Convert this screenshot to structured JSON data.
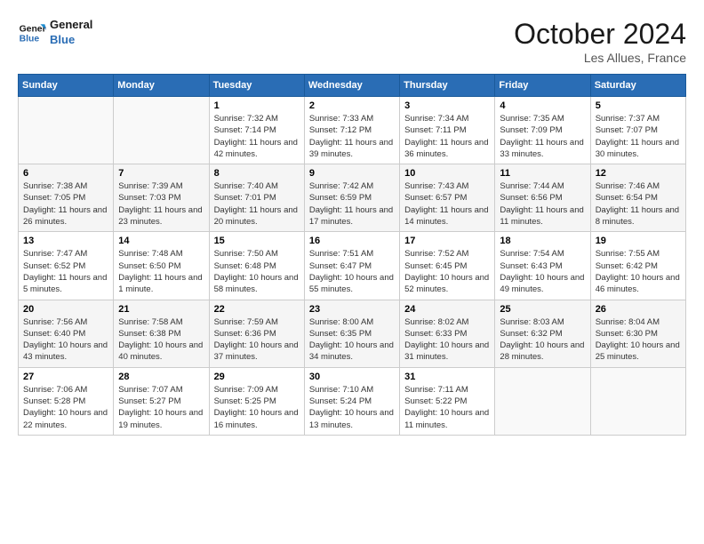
{
  "logo": {
    "line1": "General",
    "line2": "Blue"
  },
  "title": "October 2024",
  "location": "Les Allues, France",
  "days_header": [
    "Sunday",
    "Monday",
    "Tuesday",
    "Wednesday",
    "Thursday",
    "Friday",
    "Saturday"
  ],
  "weeks": [
    [
      {
        "day": "",
        "sunrise": "",
        "sunset": "",
        "daylight": ""
      },
      {
        "day": "",
        "sunrise": "",
        "sunset": "",
        "daylight": ""
      },
      {
        "day": "1",
        "sunrise": "Sunrise: 7:32 AM",
        "sunset": "Sunset: 7:14 PM",
        "daylight": "Daylight: 11 hours and 42 minutes."
      },
      {
        "day": "2",
        "sunrise": "Sunrise: 7:33 AM",
        "sunset": "Sunset: 7:12 PM",
        "daylight": "Daylight: 11 hours and 39 minutes."
      },
      {
        "day": "3",
        "sunrise": "Sunrise: 7:34 AM",
        "sunset": "Sunset: 7:11 PM",
        "daylight": "Daylight: 11 hours and 36 minutes."
      },
      {
        "day": "4",
        "sunrise": "Sunrise: 7:35 AM",
        "sunset": "Sunset: 7:09 PM",
        "daylight": "Daylight: 11 hours and 33 minutes."
      },
      {
        "day": "5",
        "sunrise": "Sunrise: 7:37 AM",
        "sunset": "Sunset: 7:07 PM",
        "daylight": "Daylight: 11 hours and 30 minutes."
      }
    ],
    [
      {
        "day": "6",
        "sunrise": "Sunrise: 7:38 AM",
        "sunset": "Sunset: 7:05 PM",
        "daylight": "Daylight: 11 hours and 26 minutes."
      },
      {
        "day": "7",
        "sunrise": "Sunrise: 7:39 AM",
        "sunset": "Sunset: 7:03 PM",
        "daylight": "Daylight: 11 hours and 23 minutes."
      },
      {
        "day": "8",
        "sunrise": "Sunrise: 7:40 AM",
        "sunset": "Sunset: 7:01 PM",
        "daylight": "Daylight: 11 hours and 20 minutes."
      },
      {
        "day": "9",
        "sunrise": "Sunrise: 7:42 AM",
        "sunset": "Sunset: 6:59 PM",
        "daylight": "Daylight: 11 hours and 17 minutes."
      },
      {
        "day": "10",
        "sunrise": "Sunrise: 7:43 AM",
        "sunset": "Sunset: 6:57 PM",
        "daylight": "Daylight: 11 hours and 14 minutes."
      },
      {
        "day": "11",
        "sunrise": "Sunrise: 7:44 AM",
        "sunset": "Sunset: 6:56 PM",
        "daylight": "Daylight: 11 hours and 11 minutes."
      },
      {
        "day": "12",
        "sunrise": "Sunrise: 7:46 AM",
        "sunset": "Sunset: 6:54 PM",
        "daylight": "Daylight: 11 hours and 8 minutes."
      }
    ],
    [
      {
        "day": "13",
        "sunrise": "Sunrise: 7:47 AM",
        "sunset": "Sunset: 6:52 PM",
        "daylight": "Daylight: 11 hours and 5 minutes."
      },
      {
        "day": "14",
        "sunrise": "Sunrise: 7:48 AM",
        "sunset": "Sunset: 6:50 PM",
        "daylight": "Daylight: 11 hours and 1 minute."
      },
      {
        "day": "15",
        "sunrise": "Sunrise: 7:50 AM",
        "sunset": "Sunset: 6:48 PM",
        "daylight": "Daylight: 10 hours and 58 minutes."
      },
      {
        "day": "16",
        "sunrise": "Sunrise: 7:51 AM",
        "sunset": "Sunset: 6:47 PM",
        "daylight": "Daylight: 10 hours and 55 minutes."
      },
      {
        "day": "17",
        "sunrise": "Sunrise: 7:52 AM",
        "sunset": "Sunset: 6:45 PM",
        "daylight": "Daylight: 10 hours and 52 minutes."
      },
      {
        "day": "18",
        "sunrise": "Sunrise: 7:54 AM",
        "sunset": "Sunset: 6:43 PM",
        "daylight": "Daylight: 10 hours and 49 minutes."
      },
      {
        "day": "19",
        "sunrise": "Sunrise: 7:55 AM",
        "sunset": "Sunset: 6:42 PM",
        "daylight": "Daylight: 10 hours and 46 minutes."
      }
    ],
    [
      {
        "day": "20",
        "sunrise": "Sunrise: 7:56 AM",
        "sunset": "Sunset: 6:40 PM",
        "daylight": "Daylight: 10 hours and 43 minutes."
      },
      {
        "day": "21",
        "sunrise": "Sunrise: 7:58 AM",
        "sunset": "Sunset: 6:38 PM",
        "daylight": "Daylight: 10 hours and 40 minutes."
      },
      {
        "day": "22",
        "sunrise": "Sunrise: 7:59 AM",
        "sunset": "Sunset: 6:36 PM",
        "daylight": "Daylight: 10 hours and 37 minutes."
      },
      {
        "day": "23",
        "sunrise": "Sunrise: 8:00 AM",
        "sunset": "Sunset: 6:35 PM",
        "daylight": "Daylight: 10 hours and 34 minutes."
      },
      {
        "day": "24",
        "sunrise": "Sunrise: 8:02 AM",
        "sunset": "Sunset: 6:33 PM",
        "daylight": "Daylight: 10 hours and 31 minutes."
      },
      {
        "day": "25",
        "sunrise": "Sunrise: 8:03 AM",
        "sunset": "Sunset: 6:32 PM",
        "daylight": "Daylight: 10 hours and 28 minutes."
      },
      {
        "day": "26",
        "sunrise": "Sunrise: 8:04 AM",
        "sunset": "Sunset: 6:30 PM",
        "daylight": "Daylight: 10 hours and 25 minutes."
      }
    ],
    [
      {
        "day": "27",
        "sunrise": "Sunrise: 7:06 AM",
        "sunset": "Sunset: 5:28 PM",
        "daylight": "Daylight: 10 hours and 22 minutes."
      },
      {
        "day": "28",
        "sunrise": "Sunrise: 7:07 AM",
        "sunset": "Sunset: 5:27 PM",
        "daylight": "Daylight: 10 hours and 19 minutes."
      },
      {
        "day": "29",
        "sunrise": "Sunrise: 7:09 AM",
        "sunset": "Sunset: 5:25 PM",
        "daylight": "Daylight: 10 hours and 16 minutes."
      },
      {
        "day": "30",
        "sunrise": "Sunrise: 7:10 AM",
        "sunset": "Sunset: 5:24 PM",
        "daylight": "Daylight: 10 hours and 13 minutes."
      },
      {
        "day": "31",
        "sunrise": "Sunrise: 7:11 AM",
        "sunset": "Sunset: 5:22 PM",
        "daylight": "Daylight: 10 hours and 11 minutes."
      },
      {
        "day": "",
        "sunrise": "",
        "sunset": "",
        "daylight": ""
      },
      {
        "day": "",
        "sunrise": "",
        "sunset": "",
        "daylight": ""
      }
    ]
  ]
}
